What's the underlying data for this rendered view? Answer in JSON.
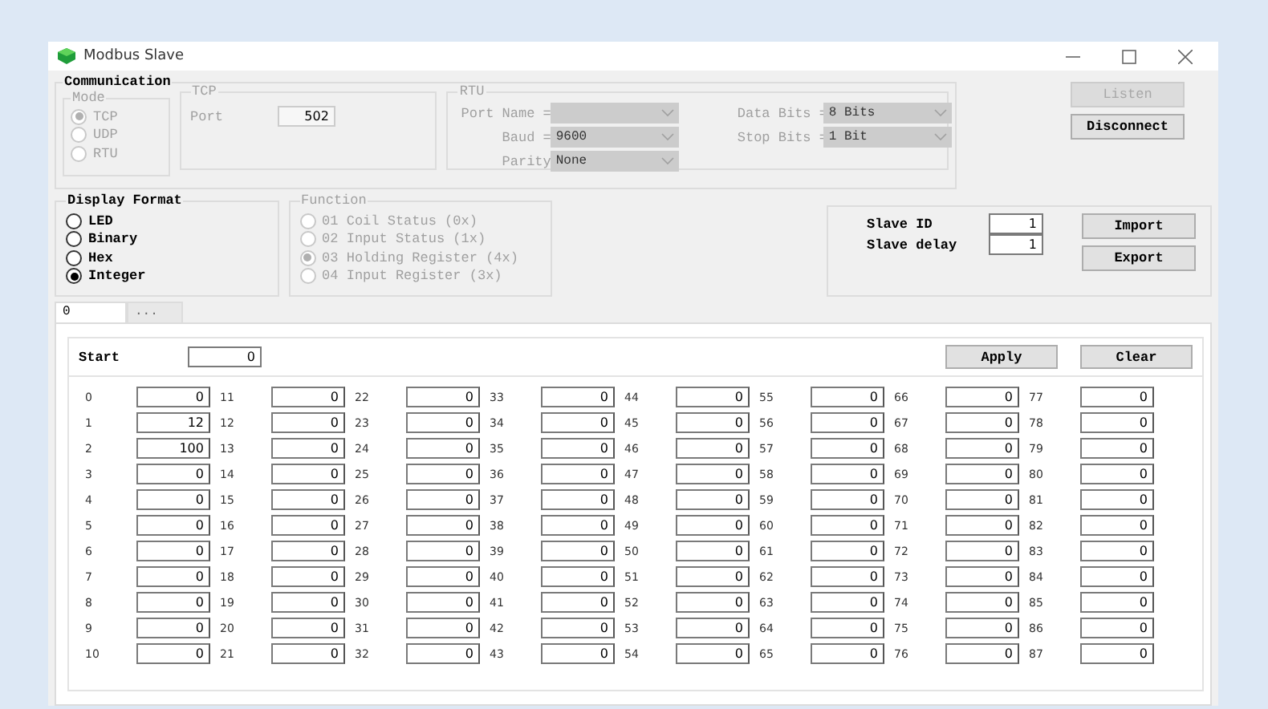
{
  "window": {
    "title": "Modbus Slave"
  },
  "communication": {
    "label": "Communication",
    "mode": {
      "label": "Mode",
      "disabled": true,
      "options": [
        {
          "label": "TCP",
          "selected": true
        },
        {
          "label": "UDP",
          "selected": false
        },
        {
          "label": "RTU",
          "selected": false
        }
      ]
    },
    "tcp": {
      "label": "TCP",
      "disabled": true,
      "port_label": "Port",
      "port": "502"
    },
    "rtu": {
      "label": "RTU",
      "disabled": true,
      "left_fields": [
        {
          "label": "Port Name ="
        },
        {
          "label": "Baud =",
          "value": "9600"
        },
        {
          "label": "Parity",
          "value": "None"
        }
      ],
      "right_fields": [
        {
          "label": "Data Bits =",
          "value": "8 Bits"
        },
        {
          "label": "Stop Bits =",
          "value": "1 Bit"
        }
      ]
    }
  },
  "connection_buttons": [
    {
      "label": "Listen",
      "disabled": true
    },
    {
      "label": "Disconnect",
      "disabled": false
    }
  ],
  "display_format": {
    "label": "Display Format",
    "disabled": false,
    "options": [
      {
        "label": "LED",
        "selected": false
      },
      {
        "label": "Binary",
        "selected": false
      },
      {
        "label": "Hex",
        "selected": false
      },
      {
        "label": "Integer",
        "selected": true
      }
    ]
  },
  "function": {
    "label": "Function",
    "disabled": true,
    "options": [
      {
        "label": "01 Coil Status (0x)",
        "selected": false
      },
      {
        "label": "02 Input Status (1x)",
        "selected": false
      },
      {
        "label": "03 Holding Register (4x)",
        "selected": true
      },
      {
        "label": "04 Input Register (3x)",
        "selected": false
      }
    ]
  },
  "slave": {
    "fields": [
      {
        "label": "Slave ID",
        "value": "1"
      },
      {
        "label": "Slave delay",
        "value": "1"
      }
    ],
    "buttons": [
      "Import",
      "Export"
    ]
  },
  "tabs": [
    {
      "label": "0",
      "selected": true
    },
    {
      "label": "...",
      "selected": false
    }
  ],
  "start": {
    "label": "Start",
    "value": "0"
  },
  "actions": [
    "Apply",
    "Clear"
  ],
  "registers": [
    {
      "cells": [
        {
          "address": "0",
          "value": "0"
        },
        {
          "address": "11",
          "value": "0"
        },
        {
          "address": "22",
          "value": "0"
        },
        {
          "address": "33",
          "value": "0"
        },
        {
          "address": "44",
          "value": "0"
        },
        {
          "address": "55",
          "value": "0"
        },
        {
          "address": "66",
          "value": "0"
        },
        {
          "address": "77",
          "value": "0"
        }
      ]
    },
    {
      "cells": [
        {
          "address": "1",
          "value": "12"
        },
        {
          "address": "12",
          "value": "0"
        },
        {
          "address": "23",
          "value": "0"
        },
        {
          "address": "34",
          "value": "0"
        },
        {
          "address": "45",
          "value": "0"
        },
        {
          "address": "56",
          "value": "0"
        },
        {
          "address": "67",
          "value": "0"
        },
        {
          "address": "78",
          "value": "0"
        }
      ]
    },
    {
      "cells": [
        {
          "address": "2",
          "value": "100"
        },
        {
          "address": "13",
          "value": "0"
        },
        {
          "address": "24",
          "value": "0"
        },
        {
          "address": "35",
          "value": "0"
        },
        {
          "address": "46",
          "value": "0"
        },
        {
          "address": "57",
          "value": "0"
        },
        {
          "address": "68",
          "value": "0"
        },
        {
          "address": "79",
          "value": "0"
        }
      ]
    },
    {
      "cells": [
        {
          "address": "3",
          "value": "0"
        },
        {
          "address": "14",
          "value": "0"
        },
        {
          "address": "25",
          "value": "0"
        },
        {
          "address": "36",
          "value": "0"
        },
        {
          "address": "47",
          "value": "0"
        },
        {
          "address": "58",
          "value": "0"
        },
        {
          "address": "69",
          "value": "0"
        },
        {
          "address": "80",
          "value": "0"
        }
      ]
    },
    {
      "cells": [
        {
          "address": "4",
          "value": "0"
        },
        {
          "address": "15",
          "value": "0"
        },
        {
          "address": "26",
          "value": "0"
        },
        {
          "address": "37",
          "value": "0"
        },
        {
          "address": "48",
          "value": "0"
        },
        {
          "address": "59",
          "value": "0"
        },
        {
          "address": "70",
          "value": "0"
        },
        {
          "address": "81",
          "value": "0"
        }
      ]
    },
    {
      "cells": [
        {
          "address": "5",
          "value": "0"
        },
        {
          "address": "16",
          "value": "0"
        },
        {
          "address": "27",
          "value": "0"
        },
        {
          "address": "38",
          "value": "0"
        },
        {
          "address": "49",
          "value": "0"
        },
        {
          "address": "60",
          "value": "0"
        },
        {
          "address": "71",
          "value": "0"
        },
        {
          "address": "82",
          "value": "0"
        }
      ]
    },
    {
      "cells": [
        {
          "address": "6",
          "value": "0"
        },
        {
          "address": "17",
          "value": "0"
        },
        {
          "address": "28",
          "value": "0"
        },
        {
          "address": "39",
          "value": "0"
        },
        {
          "address": "50",
          "value": "0"
        },
        {
          "address": "61",
          "value": "0"
        },
        {
          "address": "72",
          "value": "0"
        },
        {
          "address": "83",
          "value": "0"
        }
      ]
    },
    {
      "cells": [
        {
          "address": "7",
          "value": "0"
        },
        {
          "address": "18",
          "value": "0"
        },
        {
          "address": "29",
          "value": "0"
        },
        {
          "address": "40",
          "value": "0"
        },
        {
          "address": "51",
          "value": "0"
        },
        {
          "address": "62",
          "value": "0"
        },
        {
          "address": "73",
          "value": "0"
        },
        {
          "address": "84",
          "value": "0"
        }
      ]
    },
    {
      "cells": [
        {
          "address": "8",
          "value": "0"
        },
        {
          "address": "19",
          "value": "0"
        },
        {
          "address": "30",
          "value": "0"
        },
        {
          "address": "41",
          "value": "0"
        },
        {
          "address": "52",
          "value": "0"
        },
        {
          "address": "63",
          "value": "0"
        },
        {
          "address": "74",
          "value": "0"
        },
        {
          "address": "85",
          "value": "0"
        }
      ]
    },
    {
      "cells": [
        {
          "address": "9",
          "value": "0"
        },
        {
          "address": "20",
          "value": "0"
        },
        {
          "address": "31",
          "value": "0"
        },
        {
          "address": "42",
          "value": "0"
        },
        {
          "address": "53",
          "value": "0"
        },
        {
          "address": "64",
          "value": "0"
        },
        {
          "address": "75",
          "value": "0"
        },
        {
          "address": "86",
          "value": "0"
        }
      ]
    },
    {
      "cells": [
        {
          "address": "10",
          "value": "0"
        },
        {
          "address": "21",
          "value": "0"
        },
        {
          "address": "32",
          "value": "0"
        },
        {
          "address": "43",
          "value": "0"
        },
        {
          "address": "54",
          "value": "0"
        },
        {
          "address": "65",
          "value": "0"
        },
        {
          "address": "76",
          "value": "0"
        },
        {
          "address": "87",
          "value": "0"
        }
      ]
    }
  ]
}
